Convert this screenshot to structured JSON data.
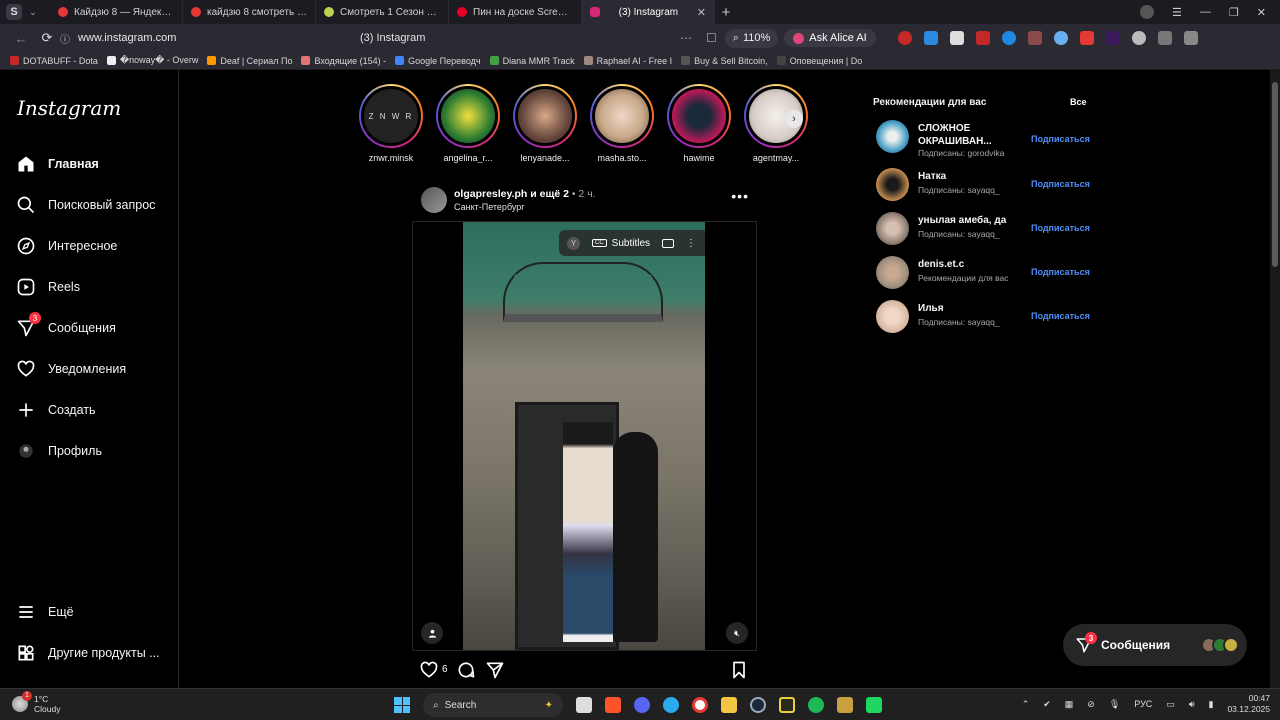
{
  "browser": {
    "tabs": [
      {
        "title": "Кайдзю 8 — Яндекс: наш",
        "color": "#e53935"
      },
      {
        "title": "кайдзю 8 смотреть — Янд",
        "color": "#e53935"
      },
      {
        "title": "Смотреть 1 Сезон 3 Сери",
        "color": "#c0d050"
      },
      {
        "title": "Пин на доске Screen wallp",
        "color": "#e60023"
      },
      {
        "title": "(3) Instagram",
        "color": "#d62976"
      }
    ],
    "url": "www.instagram.com",
    "page_title": "(3) Instagram",
    "zoom": "110%",
    "alice": "Ask Alice AI",
    "bookmarks": [
      {
        "label": "DOTABUFF - Dota",
        "color": "#c62828"
      },
      {
        "label": "�noway� - Overw",
        "color": "#eeeeee"
      },
      {
        "label": "Deaf | Сериал По",
        "color": "#ff9800"
      },
      {
        "label": "Входящие (154) -",
        "color": "#e57373"
      },
      {
        "label": "Google Переводч",
        "color": "#4285f4"
      },
      {
        "label": "Diana MMR Track",
        "color": "#43a047"
      },
      {
        "label": "Raphael AI - Free I",
        "color": "#a1887f"
      },
      {
        "label": "Buy & Sell Bitcoin,",
        "color": "#333333"
      },
      {
        "label": "Оповещения | Do",
        "color": "#222222"
      }
    ]
  },
  "instagram": {
    "logo": "Instagram",
    "nav": [
      {
        "label": "Главная",
        "icon": "home-icon"
      },
      {
        "label": "Поисковый запрос",
        "icon": "search-icon"
      },
      {
        "label": "Интересное",
        "icon": "compass-icon"
      },
      {
        "label": "Reels",
        "icon": "reels-icon"
      },
      {
        "label": "Сообщения",
        "icon": "messenger-icon",
        "badge": "3"
      },
      {
        "label": "Уведомления",
        "icon": "heart-icon"
      },
      {
        "label": "Создать",
        "icon": "plus-icon"
      },
      {
        "label": "Профиль",
        "icon": "profile-avatar"
      }
    ],
    "more": "Ещё",
    "other_products": "Другие продукты ...",
    "stories": [
      {
        "name": "znwr.minsk",
        "avatar_text": "Z N W R",
        "bg": "#222222"
      },
      {
        "name": "angelina_r...",
        "bg": "#2e7d32"
      },
      {
        "name": "lenyanade...",
        "bg": "#5d4037"
      },
      {
        "name": "masha.sto...",
        "bg": "#c8a98a"
      },
      {
        "name": "hawime",
        "bg": "#c2185b"
      },
      {
        "name": "agentmay...",
        "bg": "#d7ccc8"
      }
    ],
    "post": {
      "user": "olgapresley.ph",
      "coauthors": "и ещё 2",
      "time": "• 2 ч.",
      "location": "Санкт-Петербург",
      "subtitles": "Subtitles",
      "likes": "6"
    },
    "suggestions": {
      "title": "Рекомендации для вас",
      "all": "Все",
      "items": [
        {
          "name": "СЛОЖНОЕ ОКРАШИВАН...",
          "sub": "Подписаны: gorodvika",
          "action": "Подписаться",
          "color": "#4aa3c8"
        },
        {
          "name": "Натка",
          "sub": "Подписаны: sayaqq_",
          "action": "Подписаться",
          "color": "#c89050"
        },
        {
          "name": "унылая амеба, да",
          "sub": "Подписаны: sayaqq_",
          "action": "Подписаться",
          "color": "#8a7a70"
        },
        {
          "name": "denis.et.c",
          "sub": "Рекомендации для вас",
          "action": "Подписаться",
          "color": "#a09080"
        },
        {
          "name": "Илья",
          "sub": "Подписаны: sayaqq_",
          "action": "Подписаться",
          "color": "#d8b8a0"
        }
      ]
    },
    "messages_pill": {
      "label": "Сообщения",
      "badge": "3"
    }
  },
  "taskbar": {
    "temp": "1°C",
    "weather": "Cloudy",
    "weather_badge": "1",
    "search": "Search",
    "lang": "РУС",
    "time": "00:47",
    "date": "03.12.2025"
  }
}
